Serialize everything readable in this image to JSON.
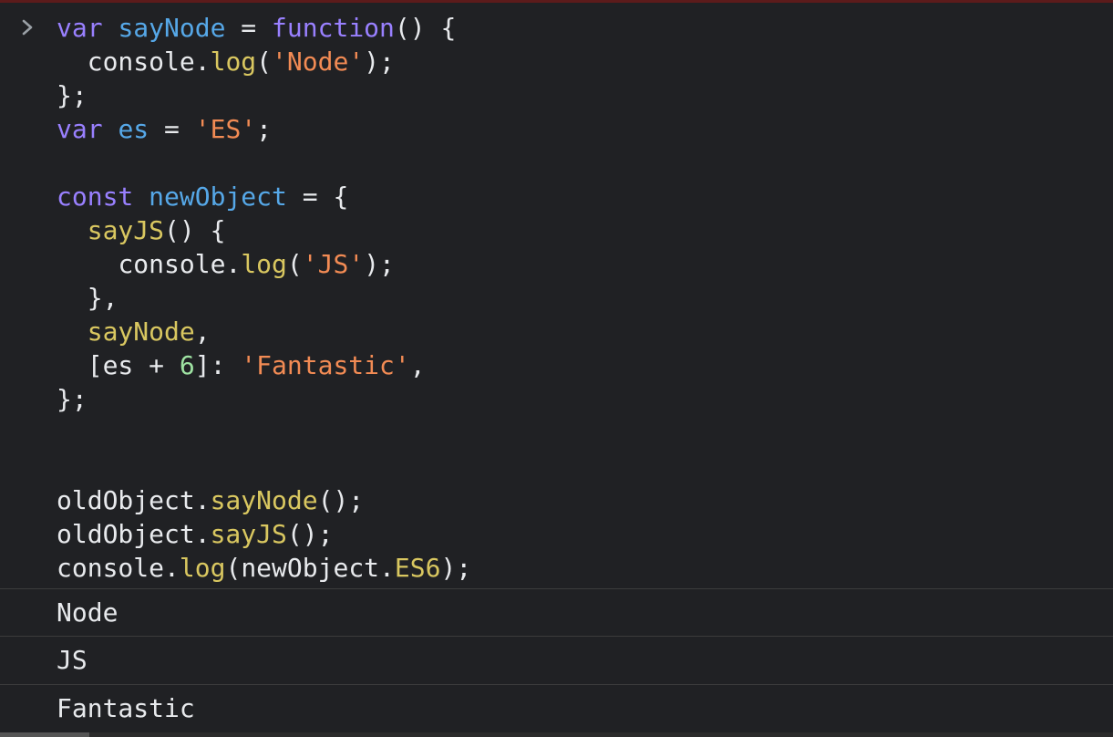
{
  "console": {
    "prompt_icon": "chevron-right-icon",
    "code_lines": [
      [
        [
          "kw",
          "var"
        ],
        [
          "op",
          " "
        ],
        [
          "def",
          "sayNode"
        ],
        [
          "op",
          " = "
        ],
        [
          "kw",
          "function"
        ],
        [
          "op",
          "() {"
        ]
      ],
      [
        [
          "op",
          "  "
        ],
        [
          "var",
          "console"
        ],
        [
          "op",
          "."
        ],
        [
          "prop",
          "log"
        ],
        [
          "op",
          "("
        ],
        [
          "str",
          "'Node'"
        ],
        [
          "op",
          ");"
        ]
      ],
      [
        [
          "op",
          "};"
        ]
      ],
      [
        [
          "kw",
          "var"
        ],
        [
          "op",
          " "
        ],
        [
          "def",
          "es"
        ],
        [
          "op",
          " = "
        ],
        [
          "str",
          "'ES'"
        ],
        [
          "op",
          ";"
        ]
      ],
      [],
      [
        [
          "kw",
          "const"
        ],
        [
          "op",
          " "
        ],
        [
          "def",
          "newObject"
        ],
        [
          "op",
          " = {"
        ]
      ],
      [
        [
          "op",
          "  "
        ],
        [
          "prop",
          "sayJS"
        ],
        [
          "op",
          "() {"
        ]
      ],
      [
        [
          "op",
          "    "
        ],
        [
          "var",
          "console"
        ],
        [
          "op",
          "."
        ],
        [
          "prop",
          "log"
        ],
        [
          "op",
          "("
        ],
        [
          "str",
          "'JS'"
        ],
        [
          "op",
          ");"
        ]
      ],
      [
        [
          "op",
          "  },"
        ]
      ],
      [
        [
          "op",
          "  "
        ],
        [
          "prop",
          "sayNode"
        ],
        [
          "op",
          ","
        ]
      ],
      [
        [
          "op",
          "  [es + "
        ],
        [
          "num",
          "6"
        ],
        [
          "op",
          "]: "
        ],
        [
          "str",
          "'Fantastic'"
        ],
        [
          "op",
          ","
        ]
      ],
      [
        [
          "op",
          "};"
        ]
      ],
      [],
      [],
      [
        [
          "var",
          "oldObject"
        ],
        [
          "op",
          "."
        ],
        [
          "prop",
          "sayNode"
        ],
        [
          "op",
          "();"
        ]
      ],
      [
        [
          "var",
          "oldObject"
        ],
        [
          "op",
          "."
        ],
        [
          "prop",
          "sayJS"
        ],
        [
          "op",
          "();"
        ]
      ],
      [
        [
          "var",
          "console"
        ],
        [
          "op",
          "."
        ],
        [
          "prop",
          "log"
        ],
        [
          "op",
          "("
        ],
        [
          "var",
          "newObject"
        ],
        [
          "op",
          "."
        ],
        [
          "prop",
          "ES6"
        ],
        [
          "op",
          ");"
        ]
      ]
    ],
    "outputs": [
      "Node",
      "JS",
      "Fantastic"
    ]
  },
  "colors": {
    "background": "#202124",
    "keyword": "#9980ff",
    "definition": "#56a8e8",
    "property": "#d9c760",
    "string": "#f28b54",
    "number": "#9ee2a2",
    "text": "#e8eaed"
  }
}
